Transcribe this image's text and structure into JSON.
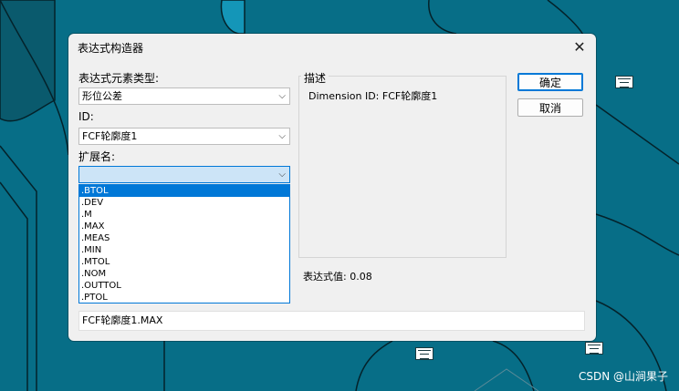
{
  "dialog": {
    "title": "表达式构造器",
    "close_glyph": "✕"
  },
  "element_type": {
    "label": "表达式元素类型:",
    "value": "形位公差"
  },
  "id_field": {
    "label": "ID:",
    "value": "FCF轮廓度1"
  },
  "extension": {
    "label": "扩展名:",
    "value": "",
    "options": [
      ".BTOL",
      ".DEV",
      ".M",
      ".MAX",
      ".MEAS",
      ".MIN",
      ".MTOL",
      ".NOM",
      ".OUTTOL",
      ".PTOL"
    ],
    "highlighted": ".BTOL"
  },
  "description": {
    "group_title": "描述",
    "text": "Dimension ID:  FCF轮廓度1"
  },
  "expression_value": {
    "text": "表达式值: 0.08"
  },
  "buttons": {
    "ok": "确定",
    "cancel": "取消"
  },
  "expression": {
    "value": "FCF轮廓度1.MAX"
  },
  "chevron_glyph": "⌵",
  "watermark": "CSDN @山涧果子",
  "colors": {
    "background": "#076e87",
    "accent": "#0078d7"
  }
}
